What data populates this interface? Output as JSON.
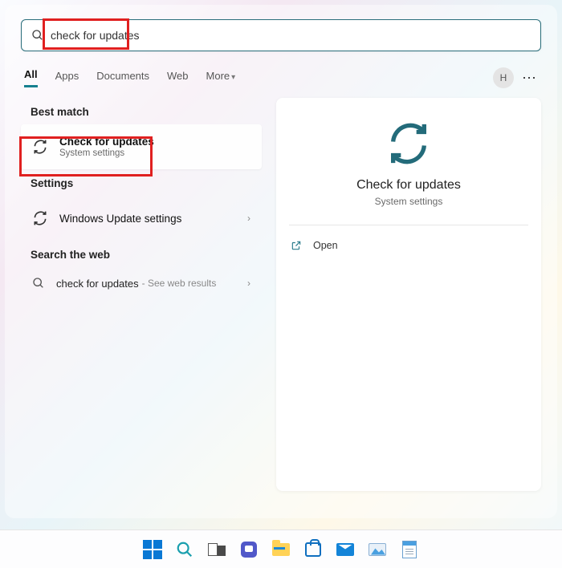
{
  "search": {
    "query": "check for updates"
  },
  "tabs": {
    "all": "All",
    "apps": "Apps",
    "documents": "Documents",
    "web": "Web",
    "more": "More"
  },
  "avatar_initial": "H",
  "left": {
    "best_match": "Best match",
    "result1": {
      "title": "Check for updates",
      "sub": "System settings"
    },
    "settings_head": "Settings",
    "result2": {
      "title": "Windows Update settings"
    },
    "search_web_head": "Search the web",
    "web": {
      "query": "check for updates",
      "hint": "- See web results"
    }
  },
  "preview": {
    "title": "Check for updates",
    "sub": "System settings",
    "open": "Open"
  },
  "taskbar": {
    "start": "Start",
    "search": "Search",
    "taskview": "Task View",
    "teams": "Chat",
    "explorer": "File Explorer",
    "store": "Microsoft Store",
    "mail": "Mail",
    "photos": "Photos",
    "notepad": "Notepad"
  }
}
